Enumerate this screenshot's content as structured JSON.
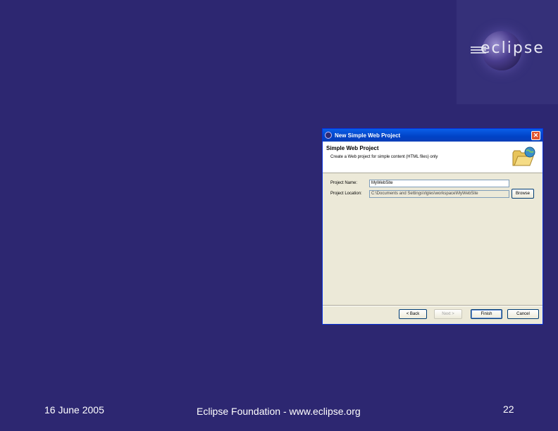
{
  "logo": {
    "text": "eclipse"
  },
  "dialog": {
    "title": "New Simple Web Project",
    "header_title": "Simple Web Project",
    "header_desc": "Create a Web project for simple content (HTML files) only",
    "project_name_label": "Project Name:",
    "project_name_value": "MyWebSite",
    "project_location_label": "Project Location:",
    "project_location_value": "C:\\Documents and Settings\\rlgles\\workspace\\MyWebSite",
    "browse_label": "Browse",
    "back_label": "< Back",
    "next_label": "Next >",
    "finish_label": "Finish",
    "cancel_label": "Cancel"
  },
  "footer": {
    "date": "16 June 2005",
    "org": "Eclipse Foundation - www.eclipse.org",
    "page": "22"
  },
  "icons": [
    "eclipse-logo-icon",
    "eclipse-app-icon",
    "close-icon",
    "web-folder-icon"
  ]
}
